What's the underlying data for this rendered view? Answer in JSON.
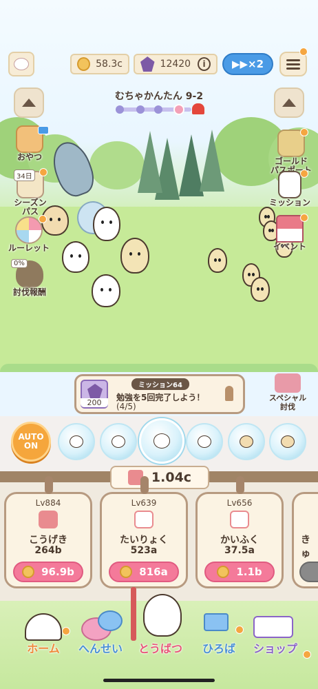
{
  "header": {
    "coins": "58.3c",
    "gems": "12420",
    "info_icon": "info-icon",
    "speed_label": "▶▶×2",
    "menu_icon": "menu-icon"
  },
  "stage": {
    "title": "むちゃかんたん 9-2",
    "up_left_icon": "triangle-up-icon",
    "up_right_icon": "triangle-up-icon"
  },
  "side_left": [
    {
      "label": "おやつ",
      "icon": "snack-icon",
      "badge": ""
    },
    {
      "label": "シーズンパス",
      "icon": "season-pass-icon",
      "badge": "34日"
    },
    {
      "label": "ルーレット",
      "icon": "roulette-icon",
      "badge": ""
    },
    {
      "label": "討伐報酬",
      "icon": "reward-bag-icon",
      "badge": "0%"
    }
  ],
  "side_right": [
    {
      "label": "ゴールドパスポート",
      "label_line1": "ゴールド",
      "label_line2": "パスポート",
      "icon": "gold-passport-icon"
    },
    {
      "label": "ミッション",
      "icon": "mission-list-icon"
    },
    {
      "label": "イベント",
      "icon": "event-tent-icon"
    }
  ],
  "mission": {
    "tag": "ミッション64",
    "reward": "200",
    "text": "勉強を5回完了しよう！",
    "count": "(4/5)",
    "bell_icon": "bell-icon"
  },
  "special": {
    "line1": "スペシャル",
    "line2": "討伐",
    "icon": "special-battle-icon"
  },
  "party": {
    "auto_line1": "AUTO",
    "auto_line2": "ON",
    "members": [
      "chara-1",
      "chara-2",
      "chara-3-selected",
      "chara-4",
      "chara-5",
      "chara-6"
    ]
  },
  "power": {
    "value": "1.04c",
    "icon": "power-icon"
  },
  "upgrades": [
    {
      "level": "Lv884",
      "name": "こうげき",
      "value": "264b",
      "cost": "96.9b",
      "icon": "attack-icon"
    },
    {
      "level": "Lv639",
      "name": "たいりょく",
      "value": "523a",
      "cost": "816a",
      "icon": "health-icon"
    },
    {
      "level": "Lv656",
      "name": "かいふく",
      "value": "37.5a",
      "cost": "1.1b",
      "icon": "heal-icon"
    },
    {
      "level": "",
      "name": "きゅ",
      "value": "",
      "cost": "",
      "icon": "partial-icon"
    }
  ],
  "nav": [
    {
      "label": "ホーム",
      "icon": "home-icon",
      "color": "#f08a3c"
    },
    {
      "label": "へんせい",
      "icon": "team-icon",
      "color": "#4a90d6"
    },
    {
      "label": "とうばつ",
      "icon": "battle-icon",
      "color": "#e8577a"
    },
    {
      "label": "ひろば",
      "icon": "plaza-icon",
      "color": "#4a90d6"
    },
    {
      "label": "ショップ",
      "icon": "shop-icon",
      "color": "#8a64c8"
    }
  ]
}
